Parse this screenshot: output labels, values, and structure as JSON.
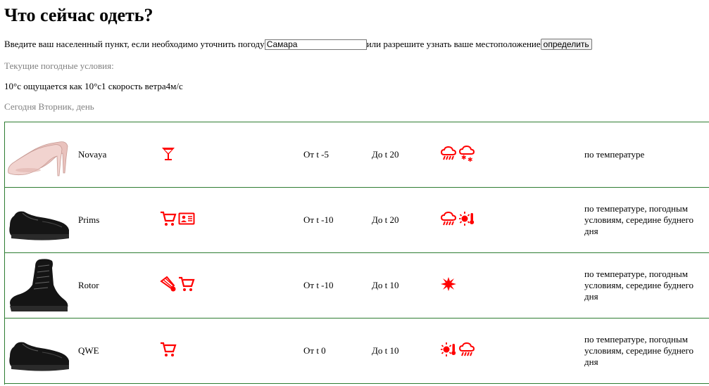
{
  "page": {
    "title": "Что сейчас одеть?",
    "city_prompt": "Введите ваш населенный пункт, если необходимо уточнить погоду",
    "city_value": "Самара",
    "location_prompt": "или разрешите узнать ваше местоположение",
    "detect_button": "определить",
    "current_label": "Текущие погодные условия:",
    "current_weather": "10°с ощущается как 10°с1 скорость ветра4м/с",
    "today": "Сегодня Вторник, день"
  },
  "colors": {
    "accent": "#ff0000",
    "border": "#2e7d32",
    "muted": "#808080"
  },
  "items": [
    {
      "name": "Novaya",
      "purpose_icons": [
        "cocktail-icon"
      ],
      "from": "От t -5",
      "to": "До t 20",
      "weather_icons": [
        "rain-cloud-icon",
        "snow-cloud-icon"
      ],
      "reason": "по температуре"
    },
    {
      "name": "Prims",
      "purpose_icons": [
        "shopping-cart-icon",
        "id-card-icon"
      ],
      "from": "От t -10",
      "to": "До t 20",
      "weather_icons": [
        "rain-cloud-icon",
        "sun-thermometer-icon"
      ],
      "reason": "по температуре, погодным условиям, середине буднего дня"
    },
    {
      "name": "Rotor",
      "purpose_icons": [
        "shuttlecock-icon",
        "shopping-cart-icon"
      ],
      "from": "От t -10",
      "to": "До t 10",
      "weather_icons": [
        "splash-icon"
      ],
      "reason": "по температуре, погодным условиям, середине буднего дня"
    },
    {
      "name": "QWE",
      "purpose_icons": [
        "shopping-cart-icon"
      ],
      "from": "От t 0",
      "to": "До t 10",
      "weather_icons": [
        "sun-thermometer-icon",
        "rain-cloud-icon"
      ],
      "reason": "по температуре, погодным условиям, середине буднего дня"
    }
  ]
}
